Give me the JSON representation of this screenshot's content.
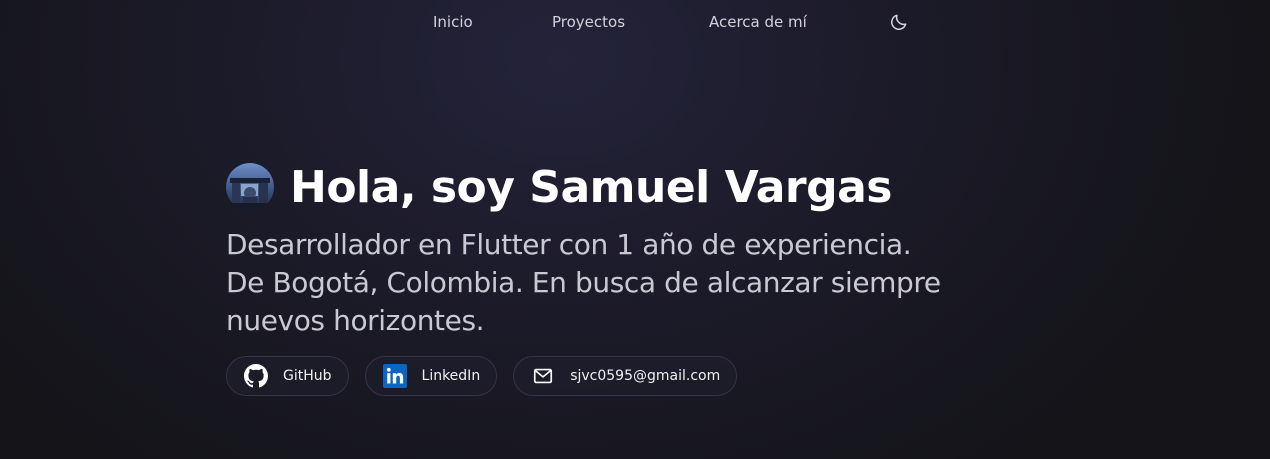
{
  "nav": {
    "items": [
      {
        "label": "Inicio"
      },
      {
        "label": "Proyectos"
      },
      {
        "label": "Acerca de mí"
      }
    ],
    "theme_icon": "moon-icon"
  },
  "hero": {
    "avatar_icon": "profile-photo",
    "title": "Hola, soy Samuel Vargas",
    "subtitle": "Desarrollador en Flutter con 1 año de experiencia. De Bogotá, Colombia. En busca de alcanzar siempre nuevos horizontes."
  },
  "links": [
    {
      "label": "GitHub",
      "icon": "github-icon"
    },
    {
      "label": "LinkedIn",
      "icon": "linkedin-icon",
      "color": "#0a66c2"
    },
    {
      "label": "sjvc0595@gmail.com",
      "icon": "mail-icon"
    }
  ],
  "colors": {
    "background": "#1c1b2a",
    "text": "#ffffff",
    "muted_text": "#c9c9d3",
    "pill_border": "#34344a"
  }
}
